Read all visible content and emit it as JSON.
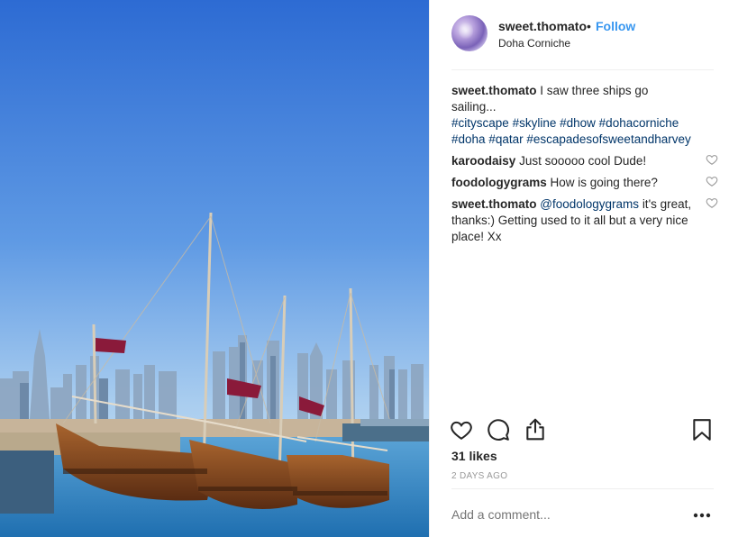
{
  "post": {
    "username": "sweet.thomato",
    "separator": "•",
    "follow_label": "Follow",
    "location": "Doha Corniche",
    "icons": {
      "like": "heart-icon",
      "comment": "comment-bubble-icon",
      "share": "share-icon",
      "save": "bookmark-icon",
      "more": "more-options-icon"
    },
    "likes": "31 likes",
    "timestamp": "2 DAYS AGO",
    "add_comment_placeholder": "Add a comment..."
  },
  "caption": {
    "user": "sweet.thomato",
    "text": "I saw three ships go sailing...",
    "hashtags": [
      "#cityscape",
      "#skyline",
      "#dhow",
      "#dohacorniche",
      "#doha",
      "#qatar",
      "#escapadesofsweetandharvey"
    ]
  },
  "comments": [
    {
      "user": "karoodaisy",
      "text": "Just sooooo cool Dude!"
    },
    {
      "user": "foodologygrams",
      "text": "How is going there?"
    },
    {
      "user": "sweet.thomato",
      "mention": "@foodologygrams",
      "text": "it's great, thanks:) Getting used to it all but a very nice place! Xx"
    }
  ],
  "colors": {
    "link": "#3897f0",
    "hashtag": "#003569",
    "muted": "#999999",
    "sky_top": "#2f6fd6",
    "sky_bottom": "#b9d8f0",
    "water": "#3f8fc9"
  }
}
